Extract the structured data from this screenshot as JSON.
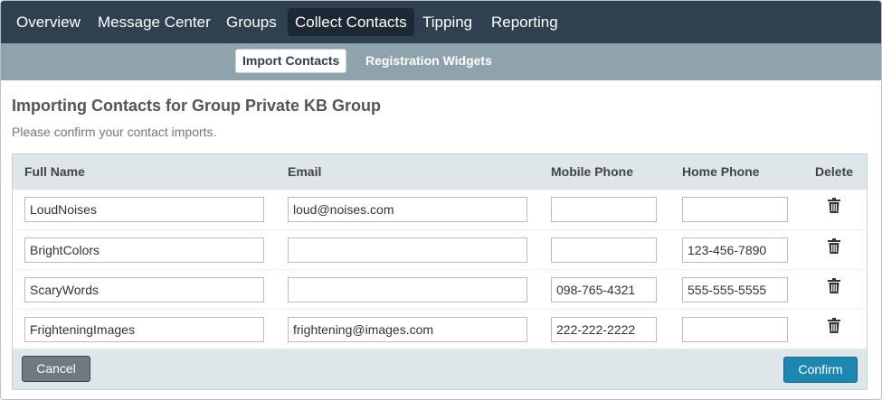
{
  "nav": {
    "tabs": [
      {
        "label": "Overview"
      },
      {
        "label": "Message Center"
      },
      {
        "label": "Groups"
      },
      {
        "label": "Collect Contacts"
      },
      {
        "label": "Tipping"
      },
      {
        "label": "Reporting"
      }
    ],
    "active_tab": "Collect Contacts"
  },
  "subnav": {
    "items": [
      {
        "label": "Import Contacts"
      },
      {
        "label": "Registration Widgets"
      }
    ],
    "active_item": "Import Contacts"
  },
  "page": {
    "title": "Importing Contacts for Group Private KB Group",
    "subtitle": "Please confirm your contact imports."
  },
  "table": {
    "columns": [
      "Full Name",
      "Email",
      "Mobile Phone",
      "Home Phone",
      "Delete"
    ],
    "rows": [
      {
        "full_name": "LoudNoises",
        "email": "loud@noises.com",
        "mobile_phone": "",
        "home_phone": ""
      },
      {
        "full_name": "BrightColors",
        "email": "",
        "mobile_phone": "",
        "home_phone": "123-456-7890"
      },
      {
        "full_name": "ScaryWords",
        "email": "",
        "mobile_phone": "098-765-4321",
        "home_phone": "555-555-5555"
      },
      {
        "full_name": "FrighteningImages",
        "email": "frightening@images.com",
        "mobile_phone": "222-222-2222",
        "home_phone": ""
      }
    ],
    "delete_icon": "trash-icon"
  },
  "actions": {
    "cancel_label": "Cancel",
    "confirm_label": "Confirm"
  },
  "colors": {
    "nav_bg": "#2f4050",
    "subnav_bg": "#8fa3ad",
    "panel_bg": "#dde6e8",
    "confirm_bg": "#1e87b0",
    "cancel_bg": "#6f7a80"
  }
}
